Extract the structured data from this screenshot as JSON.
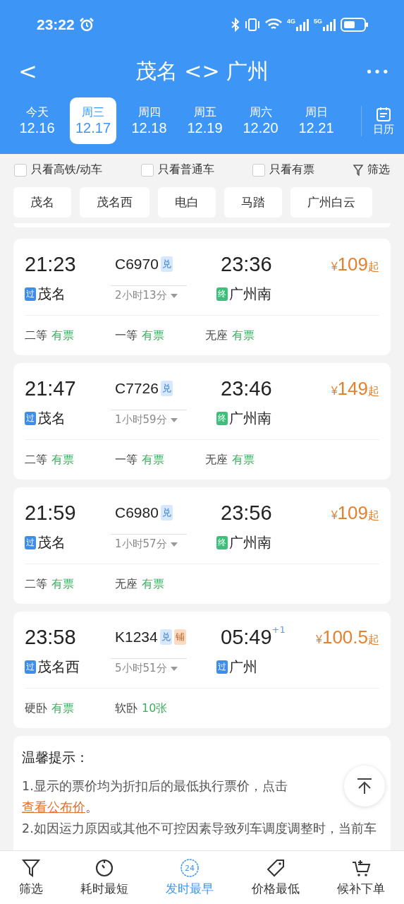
{
  "status_bar": {
    "time": "23:22",
    "network_labels": [
      "4G",
      "5G"
    ]
  },
  "header": {
    "back": "<",
    "title": "茂名 <> 广州",
    "more": "•••"
  },
  "dates": [
    {
      "weekday": "今天",
      "date": "12.16",
      "selected": false
    },
    {
      "weekday": "周三",
      "date": "12.17",
      "selected": true
    },
    {
      "weekday": "周四",
      "date": "12.18",
      "selected": false
    },
    {
      "weekday": "周五",
      "date": "12.19",
      "selected": false
    },
    {
      "weekday": "周六",
      "date": "12.20",
      "selected": false
    },
    {
      "weekday": "周日",
      "date": "12.21",
      "selected": false
    }
  ],
  "calendar_button": "日历",
  "filters": [
    {
      "label": "只看高铁/动车",
      "checked": false
    },
    {
      "label": "只看普通车",
      "checked": false
    },
    {
      "label": "只看有票",
      "checked": false
    }
  ],
  "filter_button": "筛选",
  "stations": [
    "茂名",
    "茂名西",
    "电白",
    "马踏",
    "广州白云"
  ],
  "trains": [
    {
      "depart": "21:23",
      "train_no": "C6970",
      "badges": [
        {
          "text": "兑",
          "kind": "exchange"
        }
      ],
      "arrive": "23:36",
      "price_symbol": "¥",
      "price": "109",
      "price_suffix": "起",
      "duration": "2小时13分",
      "from": {
        "tag": "过",
        "kind": "pass",
        "name": "茂名"
      },
      "to": {
        "tag": "终",
        "kind": "end",
        "name": "广州南"
      },
      "seats": [
        {
          "class": "二等",
          "availability": "有票"
        },
        {
          "class": "一等",
          "availability": "有票"
        },
        {
          "class": "无座",
          "availability": "有票"
        }
      ]
    },
    {
      "depart": "21:47",
      "train_no": "C7726",
      "badges": [
        {
          "text": "兑",
          "kind": "exchange"
        }
      ],
      "arrive": "23:46",
      "price_symbol": "¥",
      "price": "149",
      "price_suffix": "起",
      "duration": "1小时59分",
      "from": {
        "tag": "过",
        "kind": "pass",
        "name": "茂名"
      },
      "to": {
        "tag": "终",
        "kind": "end",
        "name": "广州南"
      },
      "seats": [
        {
          "class": "二等",
          "availability": "有票"
        },
        {
          "class": "一等",
          "availability": "有票"
        },
        {
          "class": "无座",
          "availability": "有票"
        }
      ]
    },
    {
      "depart": "21:59",
      "train_no": "C6980",
      "badges": [
        {
          "text": "兑",
          "kind": "exchange"
        }
      ],
      "arrive": "23:56",
      "price_symbol": "¥",
      "price": "109",
      "price_suffix": "起",
      "duration": "1小时57分",
      "from": {
        "tag": "过",
        "kind": "pass",
        "name": "茂名"
      },
      "to": {
        "tag": "终",
        "kind": "end",
        "name": "广州南"
      },
      "seats": [
        {
          "class": "二等",
          "availability": "有票"
        },
        {
          "class": "无座",
          "availability": "有票"
        }
      ]
    },
    {
      "depart": "23:58",
      "train_no": "K1234",
      "badges": [
        {
          "text": "兑",
          "kind": "exchange"
        },
        {
          "text": "铺",
          "kind": "berth"
        }
      ],
      "arrive": "05:49",
      "next_day": "+1",
      "price_symbol": "¥",
      "price": "100.5",
      "price_suffix": "起",
      "duration": "5小时51分",
      "from": {
        "tag": "过",
        "kind": "pass",
        "name": "茂名西"
      },
      "to": {
        "tag": "过",
        "kind": "pass",
        "name": "广州"
      },
      "seats": [
        {
          "class": "硬卧",
          "availability": "有票"
        },
        {
          "class": "软卧",
          "availability": "10张"
        }
      ]
    }
  ],
  "tips": {
    "title": "温馨提示：",
    "line1": "1.显示的票价均为折扣后的最低执行票价，点击 ",
    "link": "查看公布价",
    "line1_end": "。",
    "line2": "2.如因运力原因或其他不可控因素导致列车调度调整时，当前车"
  },
  "bottom_nav": [
    {
      "label": "筛选",
      "kind": "filter",
      "selected": false
    },
    {
      "label": "耗时最短",
      "kind": "clock",
      "selected": false
    },
    {
      "label": "发时最早",
      "kind": "calendar24",
      "icon_text": "24",
      "selected": true
    },
    {
      "label": "价格最低",
      "kind": "tag",
      "selected": false
    },
    {
      "label": "候补下单",
      "kind": "cart",
      "selected": false
    }
  ]
}
